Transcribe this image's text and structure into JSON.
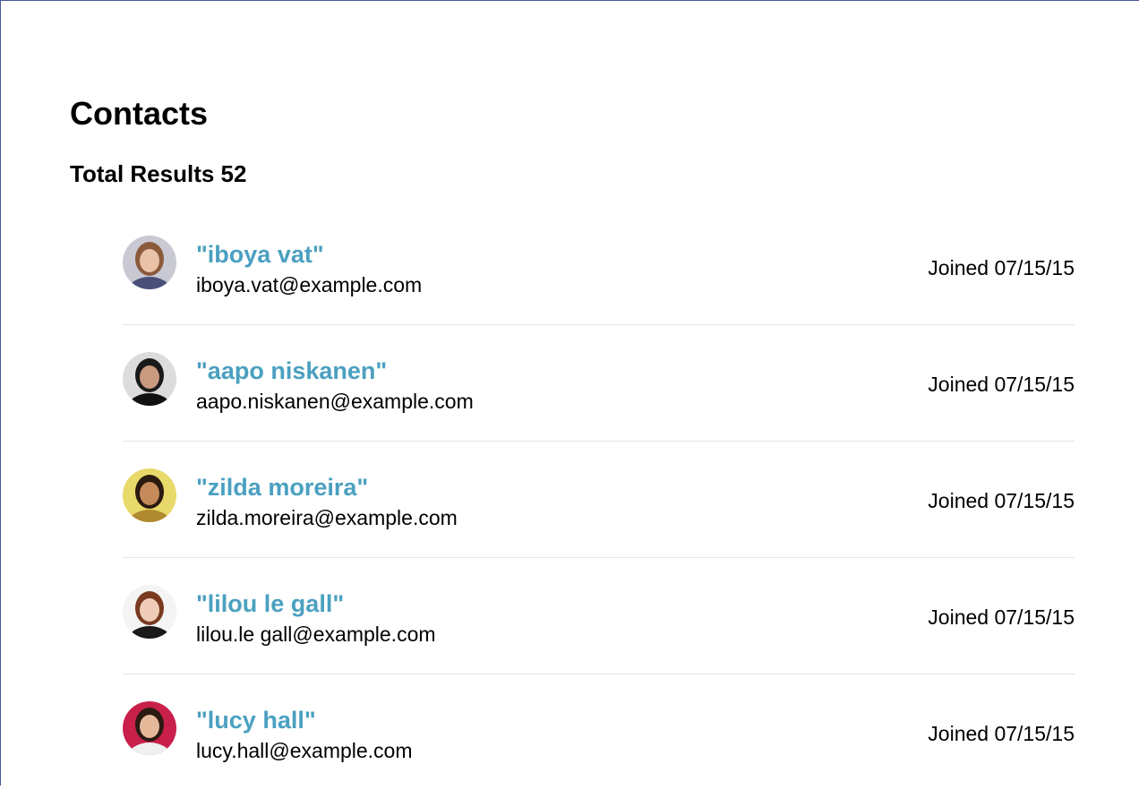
{
  "header": {
    "title": "Contacts",
    "total_results": "Total Results 52"
  },
  "contacts": [
    {
      "name": "\"iboya vat\"",
      "email": "iboya.vat@example.com",
      "joined": "Joined 07/15/15",
      "avatar": {
        "bg": "#c9c9d4",
        "hair": "#8a5a3a",
        "skin": "#e9c2a8",
        "shirt": "#4a4f7a"
      }
    },
    {
      "name": "\"aapo niskanen\"",
      "email": "aapo.niskanen@example.com",
      "joined": "Joined 07/15/15",
      "avatar": {
        "bg": "#dcdcdc",
        "hair": "#1a1a1a",
        "skin": "#c89a80",
        "shirt": "#111111"
      }
    },
    {
      "name": "\"zilda moreira\"",
      "email": "zilda.moreira@example.com",
      "joined": "Joined 07/15/15",
      "avatar": {
        "bg": "#e8d96a",
        "hair": "#2a1a10",
        "skin": "#c58a5a",
        "shirt": "#b08a30"
      }
    },
    {
      "name": "\"lilou le gall\"",
      "email": "lilou.le gall@example.com",
      "joined": "Joined 07/15/15",
      "avatar": {
        "bg": "#f4f4f4",
        "hair": "#7a3a20",
        "skin": "#f0cdb8",
        "shirt": "#1a1a1a"
      }
    },
    {
      "name": "\"lucy hall\"",
      "email": "lucy.hall@example.com",
      "joined": "Joined 07/15/15",
      "avatar": {
        "bg": "#c8204a",
        "hair": "#2a1a12",
        "skin": "#e6b89a",
        "shirt": "#f0f0f0"
      }
    }
  ]
}
